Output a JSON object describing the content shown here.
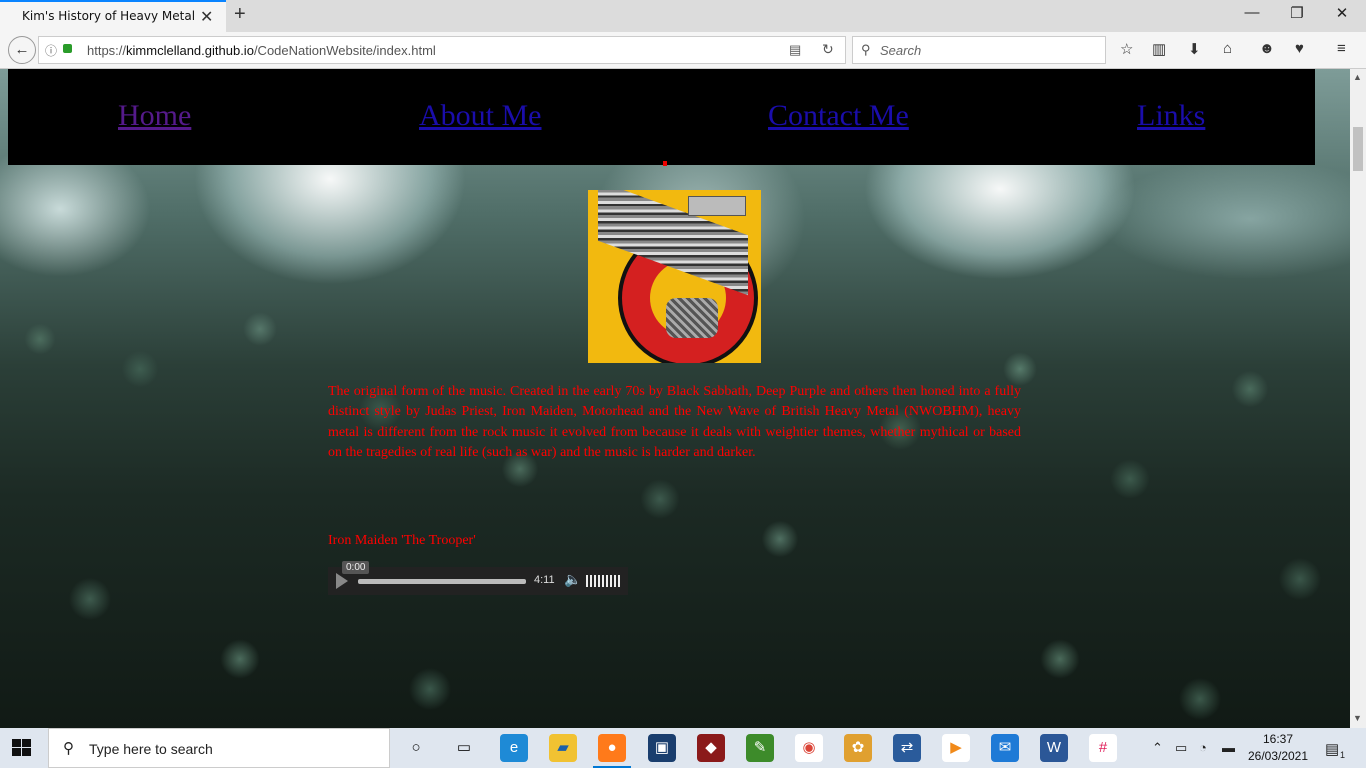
{
  "browser": {
    "tab_title": "Kim's History of Heavy Metal",
    "url_prefix": "https://",
    "url_domain": "kimmclelland.github.io",
    "url_path": "/CodeNationWebsite/index.html",
    "search_placeholder": "Search"
  },
  "site": {
    "nav": [
      "Home",
      "About Me",
      "Contact Me",
      "Links"
    ],
    "intro": "The original form of the music. Created in the early 70s by Black Sabbath, Deep Purple and others then honed into a fully distinct style by Judas Priest, Iron Maiden, Motorhead and the New Wave of British Heavy Metal (NWOBHM), heavy metal is different from the rock music it evolved from because it deals with weightier themes, whether mythical or based on the tragedies of real life (such as war) and the music is harder and darker.",
    "track_label": "Iron Maiden 'The Trooper'",
    "player": {
      "current_time": "0:00",
      "duration": "4:11",
      "progress": 0
    }
  },
  "taskbar": {
    "search_placeholder": "Type here to search",
    "time": "16:37",
    "date": "26/03/2021",
    "notification_count": "1"
  },
  "colors": {
    "link": "#1a0dab",
    "visited": "#551a8b",
    "body_text": "#ff0000",
    "nav_bg": "#000000"
  }
}
